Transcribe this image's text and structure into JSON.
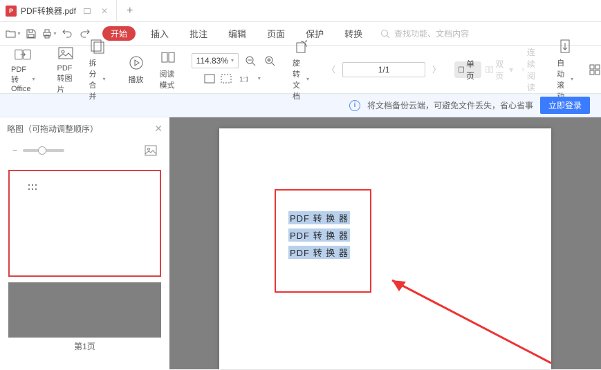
{
  "tab": {
    "title": "PDF转换器.pdf",
    "add": "+"
  },
  "menu": {
    "start": "开始",
    "items": [
      "插入",
      "批注",
      "编辑",
      "页面",
      "保护",
      "转换"
    ],
    "search_placeholder": "查找功能、文档内容"
  },
  "toolbar": {
    "pdf_to_office": "PDF转Office",
    "pdf_to_image": "PDF转图片",
    "split_merge": "拆分合并",
    "play": "播放",
    "reading_mode": "阅读模式",
    "zoom_value": "114.83%",
    "rotate_doc": "旋转文档",
    "page_indicator": "1/1",
    "view_single": "单页",
    "view_double": "双页",
    "view_continuous": "连续阅读",
    "auto_scroll": "自动滚动"
  },
  "banner": {
    "msg": "将文档备份云端，可避免文件丢失，省心省事",
    "login": "立即登录"
  },
  "thumbs": {
    "title": "略图（可拖动调整顺序）",
    "page_label": "第1页"
  },
  "document": {
    "lines": [
      "PDF 转 换 器",
      "PDF 转 换 器",
      "PDF 转 换 器"
    ]
  }
}
